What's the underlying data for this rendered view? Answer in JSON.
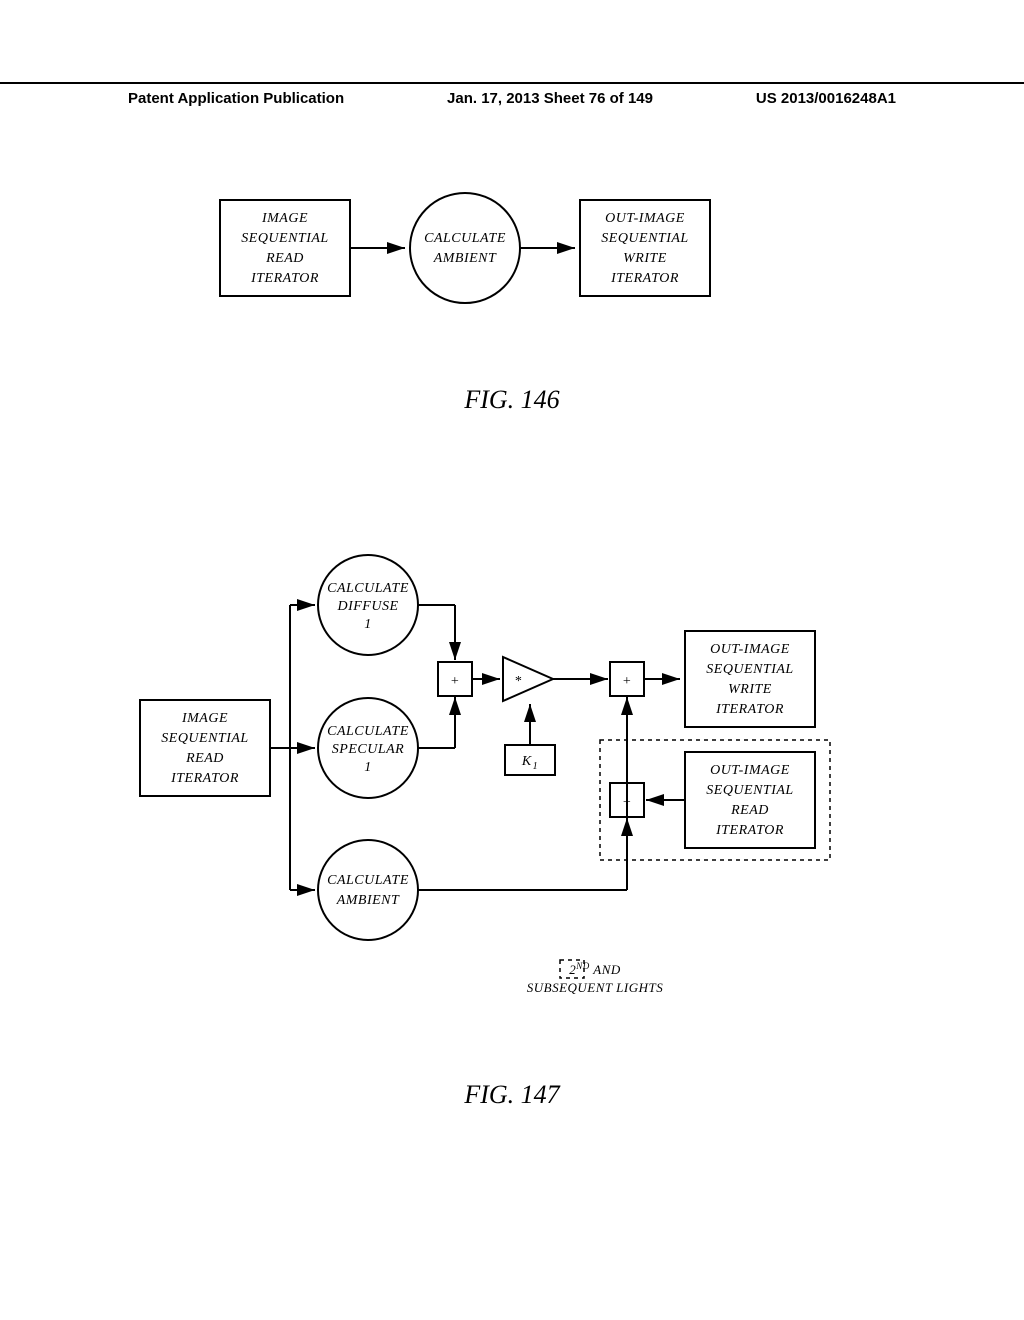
{
  "header": {
    "left": "Patent Application Publication",
    "center": "Jan. 17, 2013  Sheet 76 of 149",
    "right": "US 2013/0016248A1"
  },
  "fig146": {
    "label": "FIG. 146",
    "read_box": [
      "IMAGE",
      "SEQUENTIAL",
      "READ",
      "ITERATOR"
    ],
    "calc_circle": [
      "CALCULATE",
      "AMBIENT"
    ],
    "write_box": [
      "OUT-IMAGE",
      "SEQUENTIAL",
      "WRITE",
      "ITERATOR"
    ]
  },
  "fig147": {
    "label": "FIG. 147",
    "read_box": [
      "IMAGE",
      "SEQUENTIAL",
      "READ",
      "ITERATOR"
    ],
    "diffuse": [
      "CALCULATE",
      "DIFFUSE",
      "1"
    ],
    "specular": [
      "CALCULATE",
      "SPECULAR",
      "1"
    ],
    "ambient": [
      "CALCULATE",
      "AMBIENT"
    ],
    "plus": "+",
    "mult": "*",
    "k1": "K",
    "k1_sub": "1",
    "write_box": [
      "OUT-IMAGE",
      "SEQUENTIAL",
      "WRITE",
      "ITERATOR"
    ],
    "read_out_box": [
      "OUT-IMAGE",
      "SEQUENTIAL",
      "READ",
      "ITERATOR"
    ],
    "legend_sup": "ND",
    "legend_line1": "2",
    "legend_line1b": " AND",
    "legend_line2": "SUBSEQUENT LIGHTS"
  }
}
